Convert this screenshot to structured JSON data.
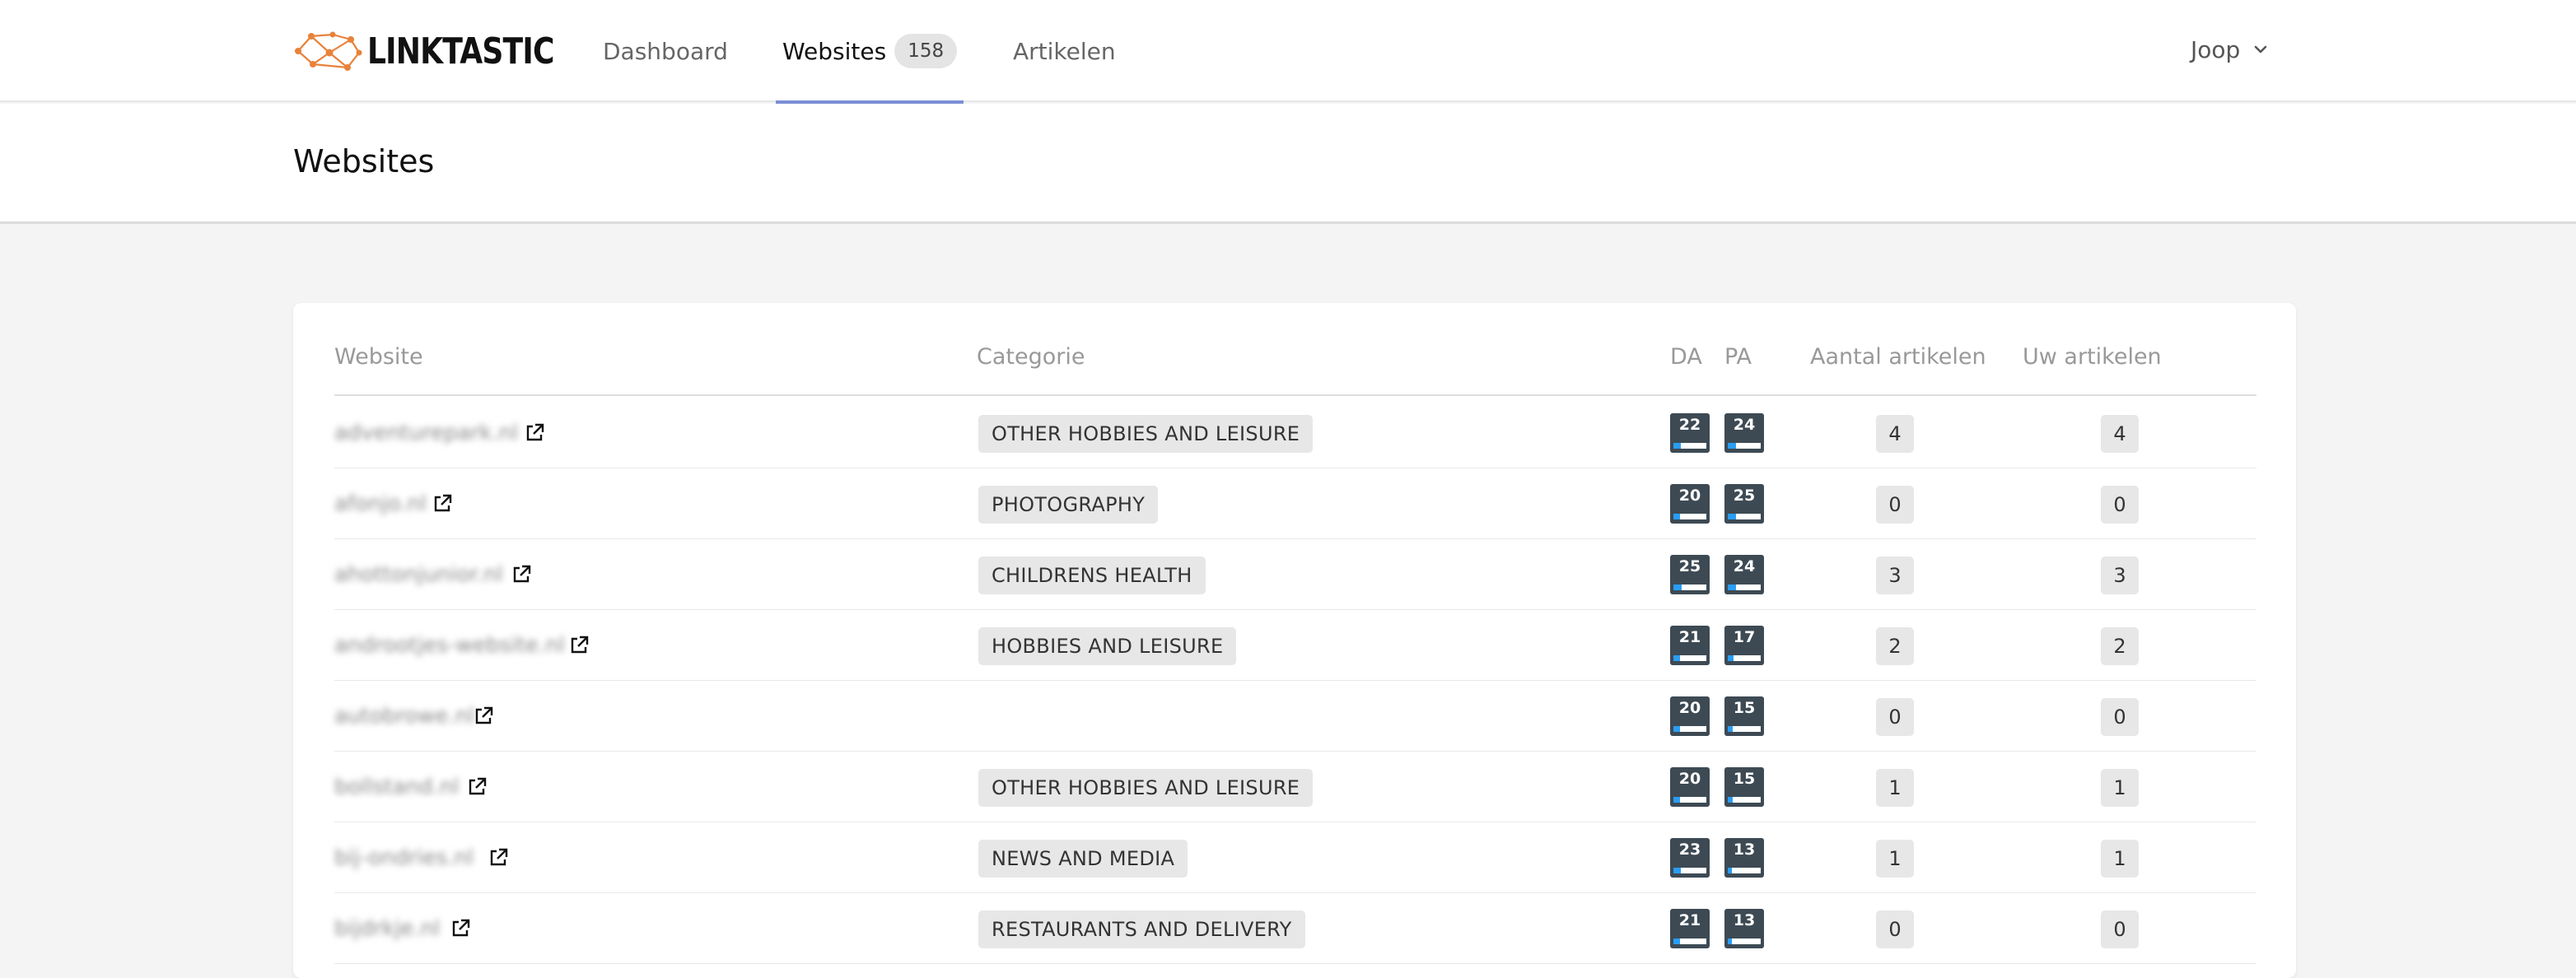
{
  "app": {
    "logo_text": "LINKTASTIC"
  },
  "nav": {
    "items": [
      {
        "label": "Dashboard"
      },
      {
        "label": "Websites",
        "badge": "158",
        "active": true
      },
      {
        "label": "Artikelen"
      }
    ],
    "user": "Joop"
  },
  "page": {
    "title": "Websites"
  },
  "table": {
    "columns": {
      "website": "Website",
      "category": "Categorie",
      "da": "DA",
      "pa": "PA",
      "article_count": "Aantal artikelen",
      "your_articles": "Uw artikelen"
    },
    "rows": [
      {
        "website": "adventurepark.nl",
        "category": "OTHER HOBBIES AND LEISURE",
        "da": "22",
        "pa": "24",
        "article_count": "4",
        "your_articles": "4"
      },
      {
        "website": "afonjo.nl",
        "category": "PHOTOGRAPHY",
        "da": "20",
        "pa": "25",
        "article_count": "0",
        "your_articles": "0"
      },
      {
        "website": "ahottonjunior.nl",
        "category": "CHILDRENS HEALTH",
        "da": "25",
        "pa": "24",
        "article_count": "3",
        "your_articles": "3"
      },
      {
        "website": "androotjes-website.nl",
        "category": "HOBBIES AND LEISURE",
        "da": "21",
        "pa": "17",
        "article_count": "2",
        "your_articles": "2"
      },
      {
        "website": "autobrowe.nl",
        "category": "",
        "da": "20",
        "pa": "15",
        "article_count": "0",
        "your_articles": "0"
      },
      {
        "website": "bollstand.nl",
        "category": "OTHER HOBBIES AND LEISURE",
        "da": "20",
        "pa": "15",
        "article_count": "1",
        "your_articles": "1"
      },
      {
        "website": "bij-ondries.nl",
        "category": "NEWS AND MEDIA",
        "da": "23",
        "pa": "13",
        "article_count": "1",
        "your_articles": "1"
      },
      {
        "website": "bijdrkje.nl",
        "category": "RESTAURANTS AND DELIVERY",
        "da": "21",
        "pa": "13",
        "article_count": "0",
        "your_articles": "0"
      }
    ]
  },
  "colors": {
    "accent": "#7b8fd6",
    "metric_bg": "#3d4a54",
    "metric_fill": "#2a9df4"
  },
  "icons": {
    "external_link": "external-link-icon",
    "chevron": "chevron-down-icon"
  }
}
